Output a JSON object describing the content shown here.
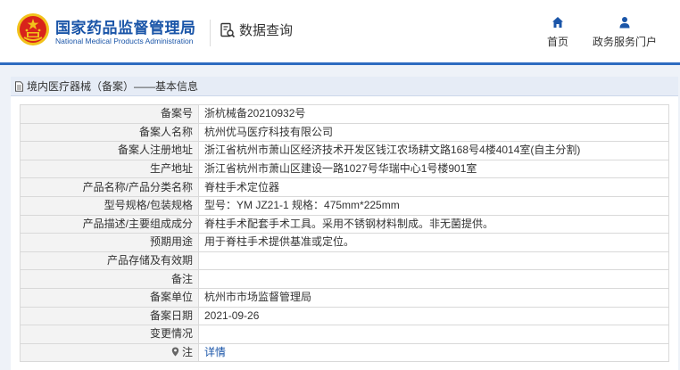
{
  "header": {
    "brand_cn": "国家药品监督管理局",
    "brand_en": "National Medical Products Administration",
    "query_label": "数据查询",
    "nav": [
      {
        "label": "首页",
        "icon": "home-icon"
      },
      {
        "label": "政务服务门户",
        "icon": "user-icon"
      }
    ]
  },
  "breadcrumb": "境内医疗器械（备案）——基本信息",
  "rows": [
    {
      "key": "备案号",
      "value": "浙杭械备20210932号"
    },
    {
      "key": "备案人名称",
      "value": "杭州优马医疗科技有限公司"
    },
    {
      "key": "备案人注册地址",
      "value": "浙江省杭州市萧山区经济技术开发区钱江农场耕文路168号4楼4014室(自主分割)"
    },
    {
      "key": "生产地址",
      "value": "浙江省杭州市萧山区建设一路1027号华瑞中心1号楼901室"
    },
    {
      "key": "产品名称/产品分类名称",
      "value": "脊柱手术定位器"
    },
    {
      "key": "型号规格/包装规格",
      "value": "型号：YM JZ21-1 规格：475mm*225mm"
    },
    {
      "key": "产品描述/主要组成成分",
      "value": "脊柱手术配套手术工具。采用不锈钢材料制成。非无菌提供。"
    },
    {
      "key": "预期用途",
      "value": "用于脊柱手术提供基准或定位。"
    },
    {
      "key": "产品存储及有效期",
      "value": ""
    },
    {
      "key": "备注",
      "value": ""
    },
    {
      "key": "备案单位",
      "value": "杭州市市场监督管理局"
    },
    {
      "key": "备案日期",
      "value": "2021-09-26"
    },
    {
      "key": "变更情况",
      "value": ""
    }
  ],
  "note_row": {
    "key": "注",
    "link": "详情"
  },
  "colors": {
    "brand_blue": "#1a55a8",
    "bar_blue": "#2d6bc0",
    "emblem_red": "#d8231b",
    "emblem_gold": "#f2c21b"
  }
}
